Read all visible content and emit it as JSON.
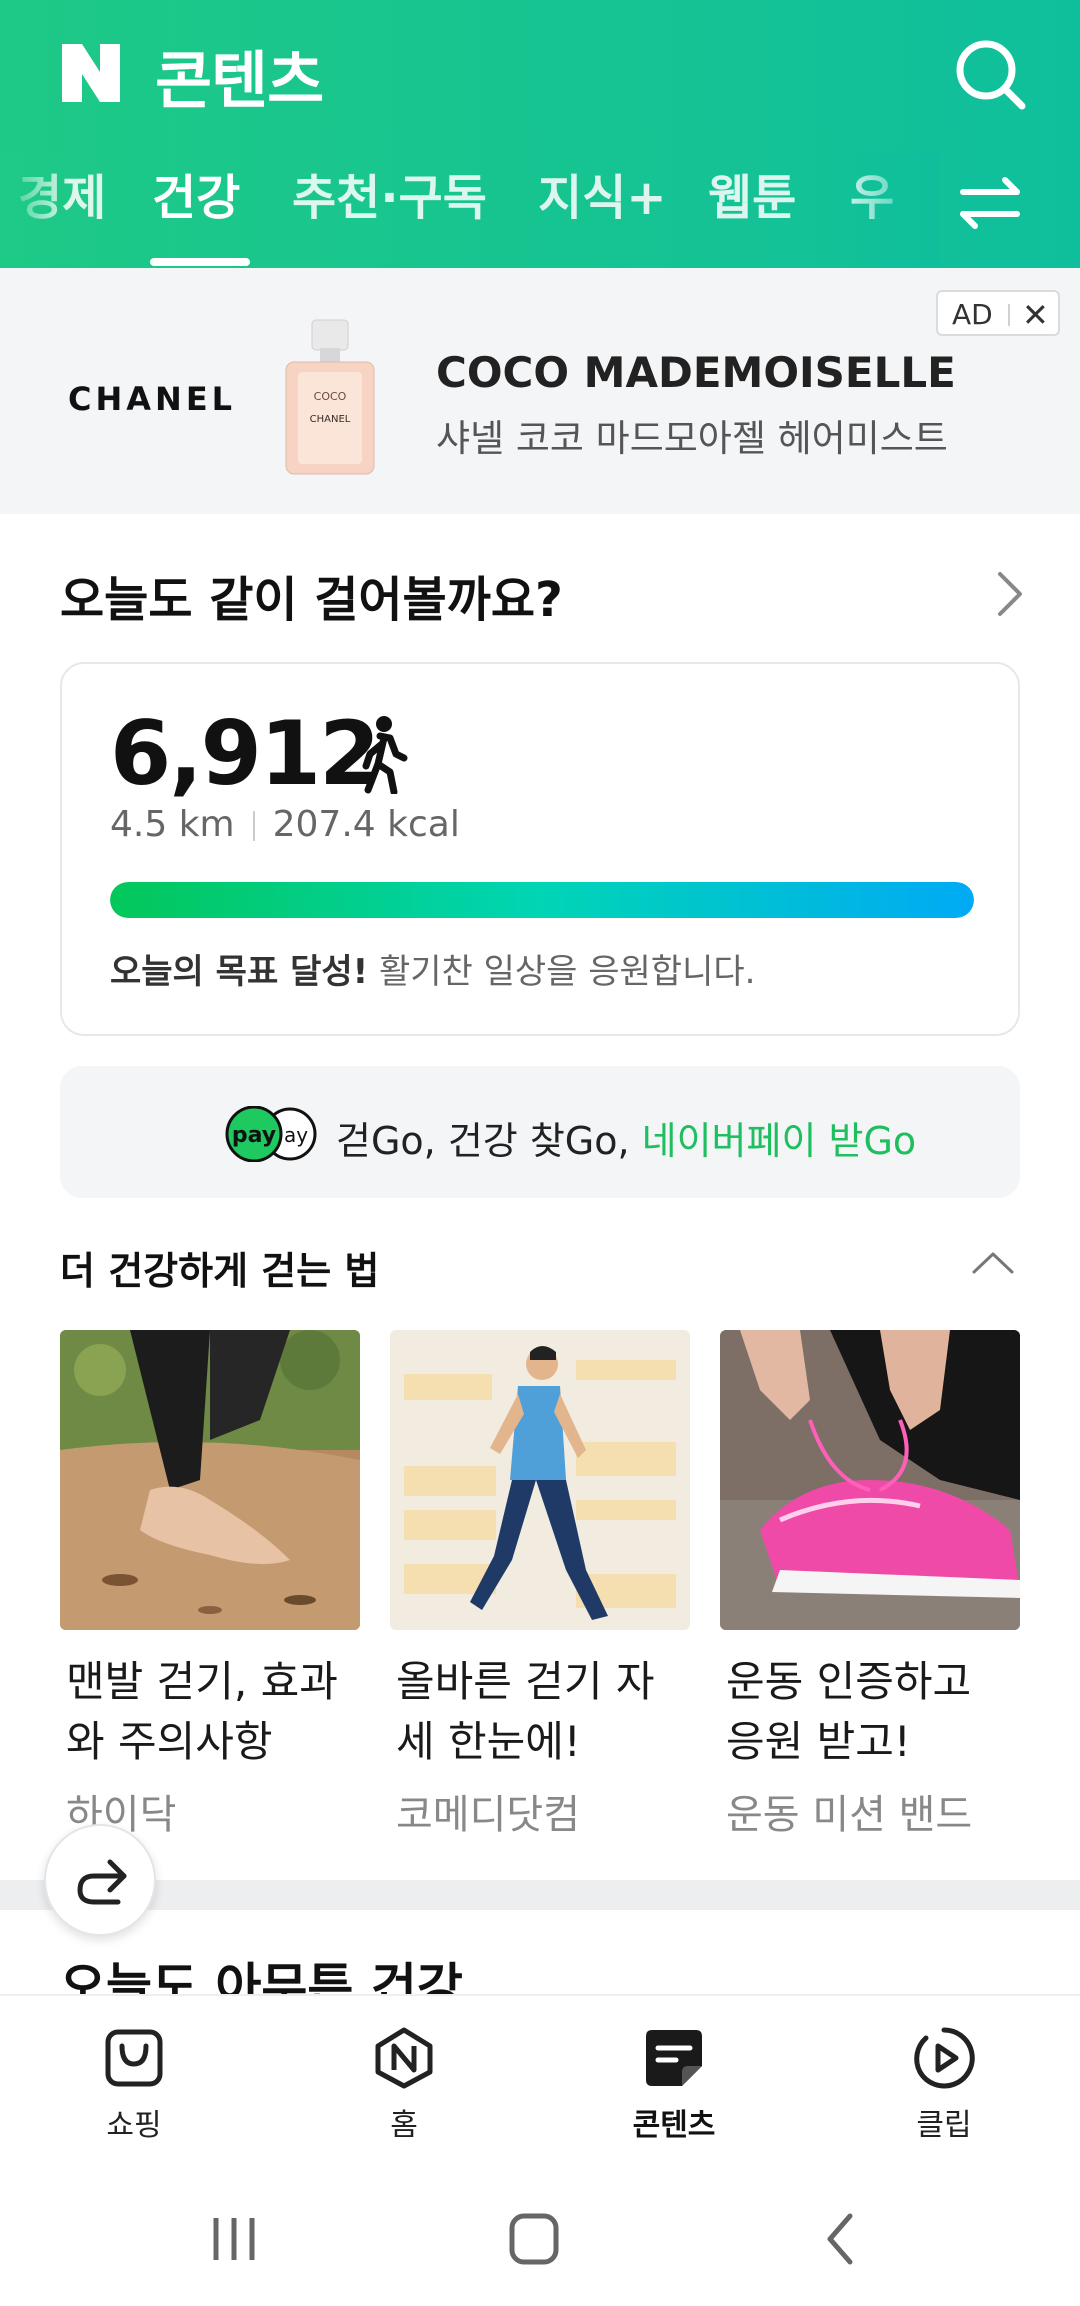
{
  "header": {
    "title": "콘텐츠",
    "logo_letter": "N",
    "tabs": [
      {
        "label": "경제"
      },
      {
        "label": "건강"
      },
      {
        "label": "추천·구독"
      },
      {
        "label": "지식+"
      },
      {
        "label": "웹툰"
      },
      {
        "label": "우"
      }
    ],
    "active_tab": "건강",
    "colors": {
      "brand": "#1ec986"
    }
  },
  "ad": {
    "badge": "AD",
    "close": "✕",
    "brand": "CHANEL",
    "title": "COCO MADEMOISELLE",
    "subtitle": "샤넬 코코 마드모아젤 헤어미스트",
    "bottle_text_1": "COCO",
    "bottle_text_2": "CHANEL"
  },
  "walking": {
    "title": "오늘도 같이 걸어볼까요?",
    "steps": "6,912",
    "distance": "4.5 km",
    "calories": "207.4 kcal",
    "progress": 1.0,
    "goal_bold": "오늘의 목표 달성!",
    "goal_rest": " 활기찬 일상을 응원합니다."
  },
  "pay": {
    "logo": "pay",
    "text": "걷Go, 건강 찾Go, ",
    "highlight": "네이버페이 받Go"
  },
  "tips": {
    "title": "더 건강하게 걷는 법",
    "cards": [
      {
        "title": "맨발 걷기, 효과와 주의사항",
        "source": "하이닥"
      },
      {
        "title": "올바른 걷기 자세 한눈에!",
        "source": "코메디닷컴"
      },
      {
        "title": "운동 인증하고 응원 받고!",
        "source": "운동 미션 밴드"
      }
    ]
  },
  "next_section": {
    "title": "오늘도 아무튼 건강"
  },
  "bottom_nav": [
    {
      "label": "쇼핑"
    },
    {
      "label": "홈"
    },
    {
      "label": "콘텐츠"
    },
    {
      "label": "클립"
    }
  ]
}
